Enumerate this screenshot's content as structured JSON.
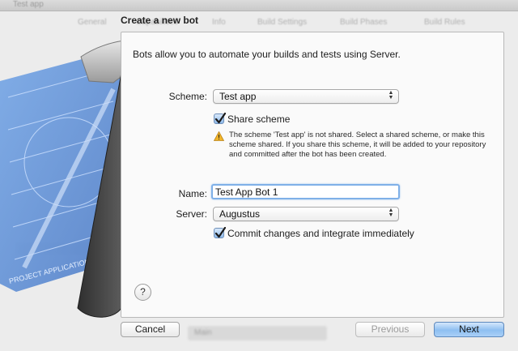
{
  "background": {
    "window_title": "Test app",
    "tabs": [
      "General",
      "Capabilities",
      "Info",
      "Build Settings",
      "Build Phases",
      "Build Rules"
    ],
    "footer_select": "Main"
  },
  "sheet": {
    "title": "Create a new bot",
    "intro": "Bots allow you to automate your builds and tests using Server.",
    "scheme": {
      "label": "Scheme:",
      "value": "Test app"
    },
    "share_scheme": {
      "label": "Share scheme",
      "checked": true
    },
    "warning": {
      "icon": "warning-triangle-icon",
      "text": "The scheme 'Test app' is not shared. Select a shared scheme, or make this scheme shared. If you share this scheme, it will be added to your repository and committed after the bot has been created."
    },
    "name": {
      "label": "Name:",
      "value": "Test App Bot 1"
    },
    "server": {
      "label": "Server:",
      "value": "Augustus"
    },
    "commit": {
      "label": "Commit changes and integrate immediately",
      "checked": true
    },
    "help_label": "?"
  },
  "footer": {
    "cancel": "Cancel",
    "previous": "Previous",
    "next": "Next"
  },
  "colors": {
    "primary_button": "#8ebff1",
    "blueprint": "#5b8fd6",
    "warning": "#f0b429"
  }
}
